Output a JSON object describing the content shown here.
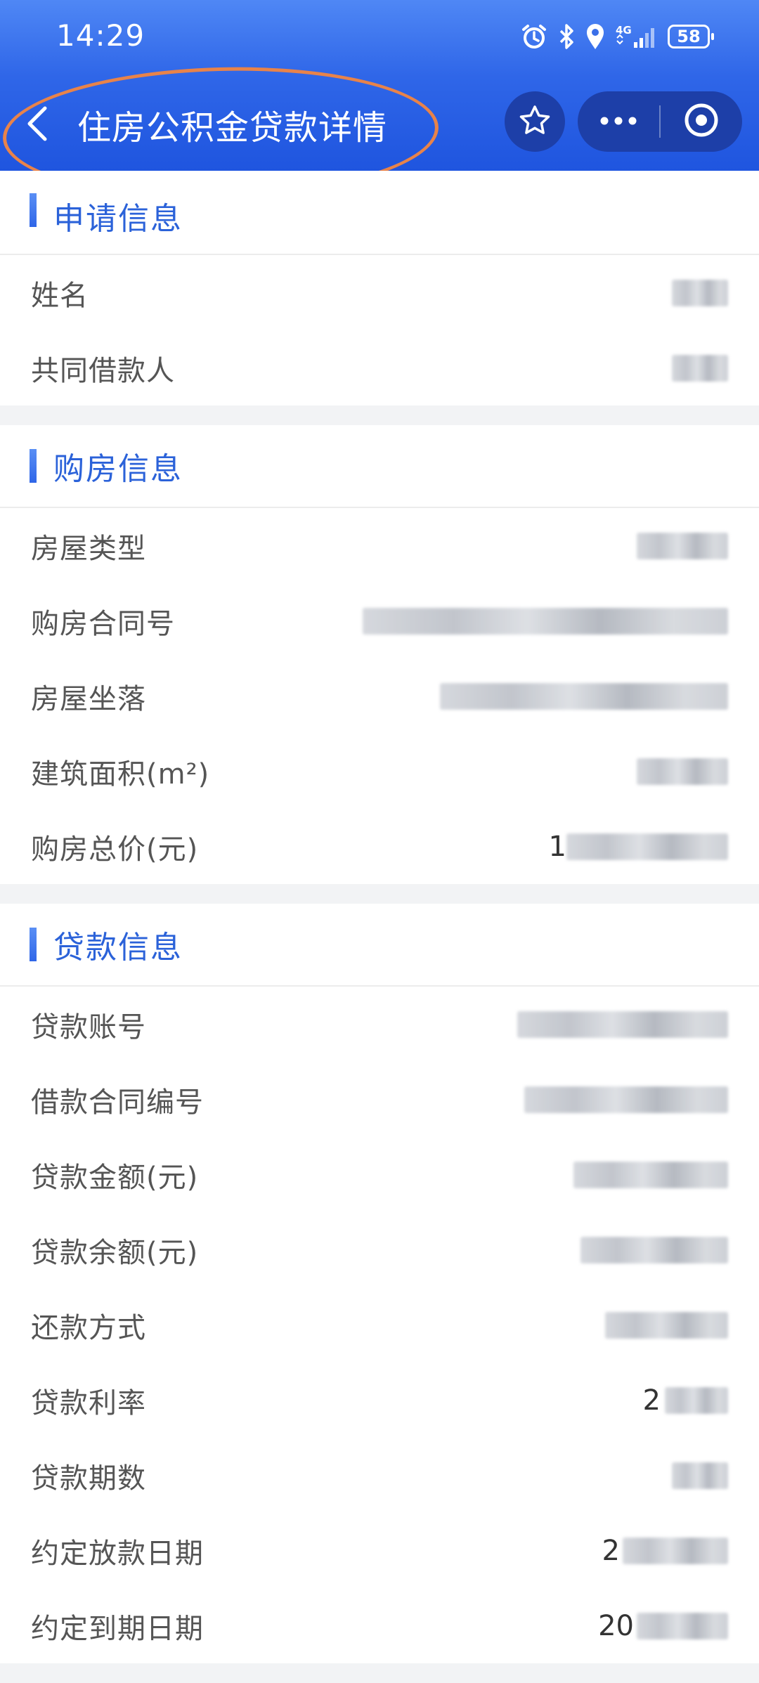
{
  "status_bar": {
    "time": "14:29",
    "network": "4G",
    "battery": "58",
    "icons": [
      "alarm-icon",
      "bluetooth-icon",
      "location-icon",
      "signal-icon",
      "battery-icon"
    ]
  },
  "navbar": {
    "title": "住房公积金贷款详情",
    "icons": [
      "back-icon",
      "star-icon",
      "more-icon",
      "close-circle-icon"
    ]
  },
  "colors": {
    "header_top": "#4f87f5",
    "header_bottom": "#1f55df",
    "accent": "#2b62d9",
    "annotation": "#e8834a"
  },
  "sections": [
    {
      "title": "申请信息",
      "rows": [
        {
          "label": "姓名",
          "value_prefix": ""
        },
        {
          "label": "共同借款人",
          "value_prefix": ""
        }
      ]
    },
    {
      "title": "购房信息",
      "rows": [
        {
          "label": "房屋类型",
          "value_prefix": ""
        },
        {
          "label": "购房合同号",
          "value_prefix": ""
        },
        {
          "label": "房屋坐落",
          "value_prefix": ""
        },
        {
          "label": "建筑面积(m²)",
          "value_prefix": ""
        },
        {
          "label": "购房总价(元)",
          "value_prefix": "1"
        }
      ]
    },
    {
      "title": "贷款信息",
      "rows": [
        {
          "label": "贷款账号",
          "value_prefix": ""
        },
        {
          "label": "借款合同编号",
          "value_prefix": ""
        },
        {
          "label": "贷款金额(元)",
          "value_prefix": ""
        },
        {
          "label": "贷款余额(元)",
          "value_prefix": ""
        },
        {
          "label": "还款方式",
          "value_prefix": ""
        },
        {
          "label": "贷款利率",
          "value_prefix": "2"
        },
        {
          "label": "贷款期数",
          "value_prefix": ""
        },
        {
          "label": "约定放款日期",
          "value_prefix": "2"
        },
        {
          "label": "约定到期日期",
          "value_prefix": "20"
        }
      ]
    }
  ]
}
